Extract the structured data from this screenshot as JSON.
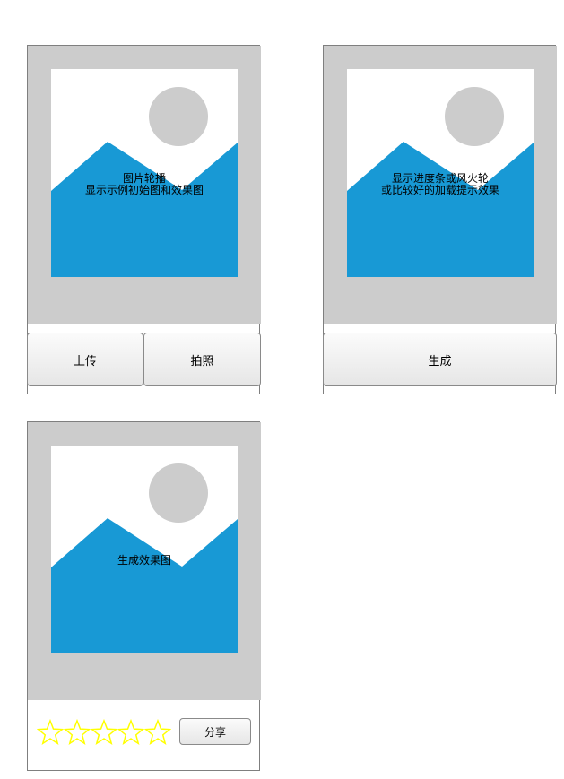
{
  "card_upload": {
    "caption_line1": "图片轮播",
    "caption_line2": "显示示例初始图和效果图",
    "upload_label": "上传",
    "photo_label": "拍照"
  },
  "card_generate": {
    "caption_line1": "显示进度条或风火轮",
    "caption_line2": "或比较好的加载提示效果",
    "generate_label": "生成"
  },
  "card_result": {
    "caption": "生成效果图",
    "rating_max": 5,
    "rating_value": 0,
    "share_label": "分享"
  },
  "colors": {
    "placeholder_bg": "#cccccc",
    "image_sky": "#ffffff",
    "image_mountain": "#1899d5",
    "image_sun": "#cccccc",
    "star_outline": "#ffff00"
  }
}
